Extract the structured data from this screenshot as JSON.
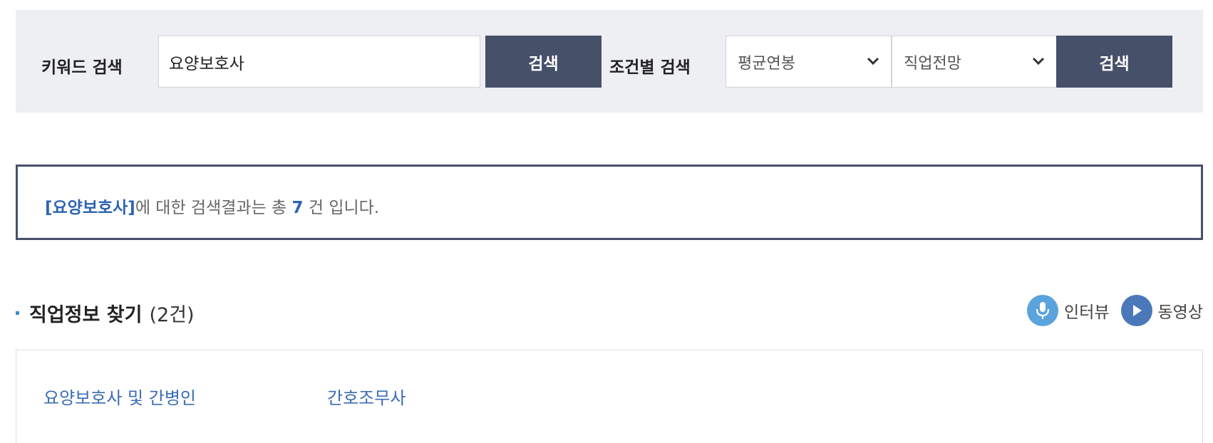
{
  "search": {
    "keyword_label": "키워드 검색",
    "keyword_value": "요양보호사",
    "keyword_button": "검색",
    "condition_label": "조건별 검색",
    "select_salary": "평균연봉",
    "select_outlook": "직업전망",
    "condition_button": "검색"
  },
  "result": {
    "keyword_display": "[요양보호사]",
    "text_before_count": "에 대한 검색결과는 총 ",
    "count": "7",
    "text_after_count": " 건 입니다."
  },
  "section": {
    "title": "직업정보 찾기",
    "count": "(2건)",
    "legend_interview": "인터뷰",
    "legend_video": "동영상"
  },
  "jobs": [
    {
      "name": "요양보호사 및 간병인"
    },
    {
      "name": "간호조무사"
    }
  ],
  "icons": {
    "legend_interview": "microphone-icon",
    "legend_video": "play-icon",
    "select_arrow": "chevron-down-icon"
  },
  "colors": {
    "button_bg": "#475069",
    "panel_bg": "#eeeff3",
    "link": "#3b6cb4",
    "accent": "#2f64b1"
  }
}
